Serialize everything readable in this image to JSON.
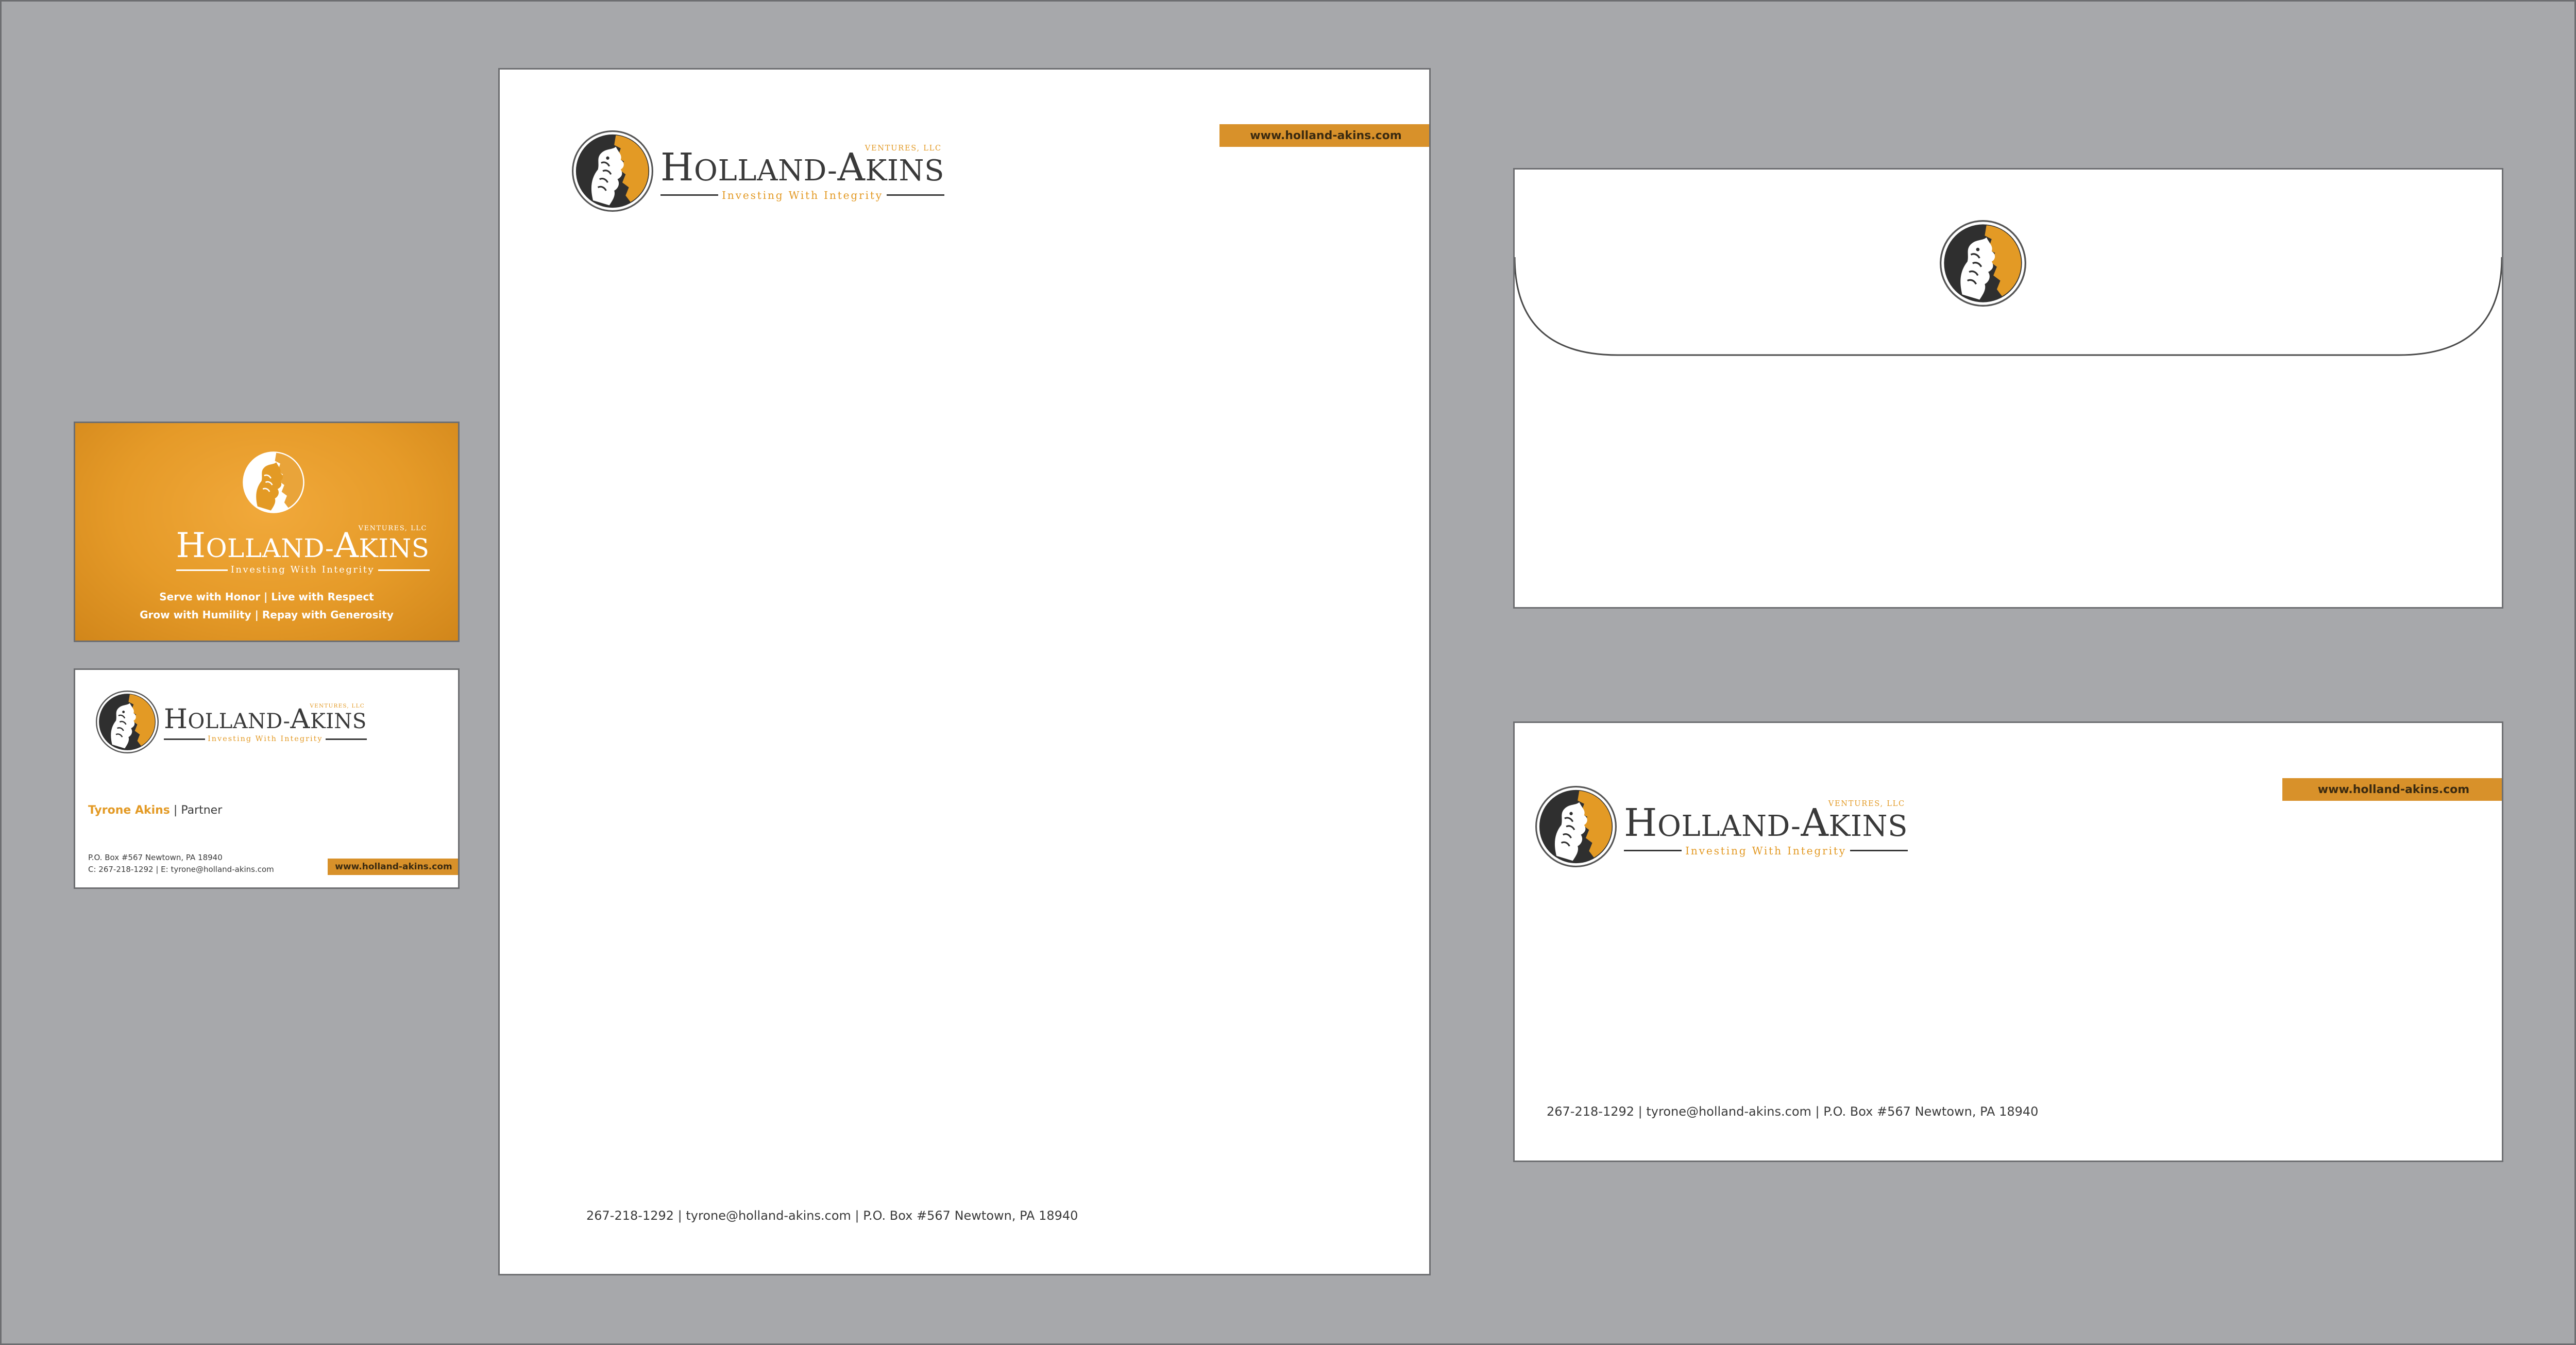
{
  "brand": {
    "name_first_cap": "H",
    "name_first_rest": "OLLAND",
    "name_dash": "-",
    "name_second_cap": "A",
    "name_second_rest": "KINS",
    "ventures": "VENTURES, LLC",
    "tagline": "Investing With Integrity",
    "website": "www.holland-akins.com",
    "icon": "lion-head-icon"
  },
  "colors": {
    "accent": "#e39a25",
    "dark": "#3a3a3a",
    "background": "#a7a8ab"
  },
  "business_card_front": {
    "motto_line_1": "Serve with Honor | Live with Respect",
    "motto_line_2": "Grow with Humility   | Repay with Generosity"
  },
  "business_card_back": {
    "person_name": "Tyrone Akins",
    "separator": " | ",
    "role": "Partner",
    "address": "P.O. Box #567 Newtown, PA 18940",
    "phone_email": "C: 267-218-1292 | E: tyrone@holland-akins.com"
  },
  "letterhead": {
    "footer": "267-218-1292 | tyrone@holland-akins.com | P.O. Box #567 Newtown, PA 18940"
  },
  "envelope_front": {
    "footer": "267-218-1292 | tyrone@holland-akins.com | P.O. Box #567 Newtown, PA 18940"
  }
}
